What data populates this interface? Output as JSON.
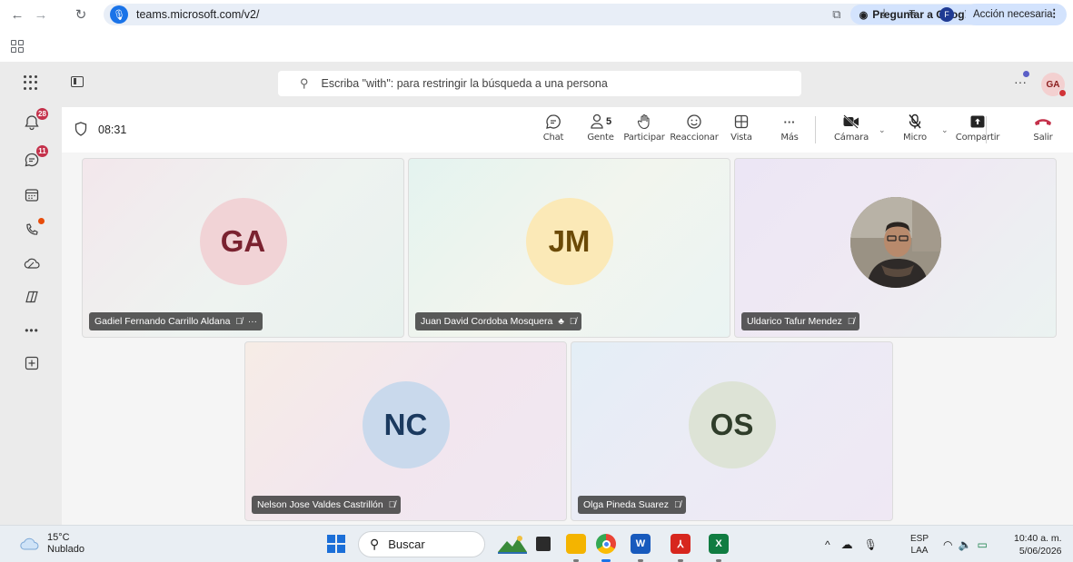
{
  "browser": {
    "url": "teams.microsoft.com/v2/",
    "google_button": "Preguntar a Google",
    "profile_initial": "F",
    "action_button": "Acción necesaria"
  },
  "teams": {
    "search_placeholder": "Escriba \"with\": para restringir la búsqueda a una persona",
    "user_initials": "GA",
    "rail": {
      "activity_badge": "28",
      "chat_badge": "11",
      "more_label": "•••"
    }
  },
  "meeting": {
    "timer": "08:31",
    "people_count": "5",
    "toolbar": {
      "chat": "Chat",
      "people": "Gente",
      "raise": "Participar",
      "react": "Reaccionar",
      "view": "Vista",
      "more": "Más",
      "camera": "Cámara",
      "mic": "Micro",
      "share": "Compartir",
      "leave": "Salir"
    },
    "participants": [
      {
        "initials": "GA",
        "name": "Gadiel Fernando Carrillo Aldana",
        "avatar_bg": "#f1d3d6",
        "avatar_fg": "#7a2230"
      },
      {
        "initials": "JM",
        "name": "Juan David Cordoba Mosquera",
        "avatar_bg": "#fbe9b7",
        "avatar_fg": "#6b4a07"
      },
      {
        "initials": "",
        "name": "Uldarico Tafur Mendez"
      },
      {
        "initials": "NC",
        "name": "Nelson Jose Valdes Castrillón",
        "avatar_bg": "#c9d9ec",
        "avatar_fg": "#1b3a5f"
      },
      {
        "initials": "OS",
        "name": "Olga Pineda Suarez",
        "avatar_bg": "#dde3d6",
        "avatar_fg": "#2f3d2a"
      }
    ]
  },
  "taskbar": {
    "temperature": "15°C",
    "condition": "Nublado",
    "search": "Buscar",
    "lang_top": "ESP",
    "lang_bottom": "LAA",
    "time": "10:40 a. m.",
    "date": "5/06/2026"
  },
  "colors": {
    "teams_accent": "#5b5fc7",
    "leave_red": "#c4314b",
    "badge_red": "#c4314b"
  }
}
